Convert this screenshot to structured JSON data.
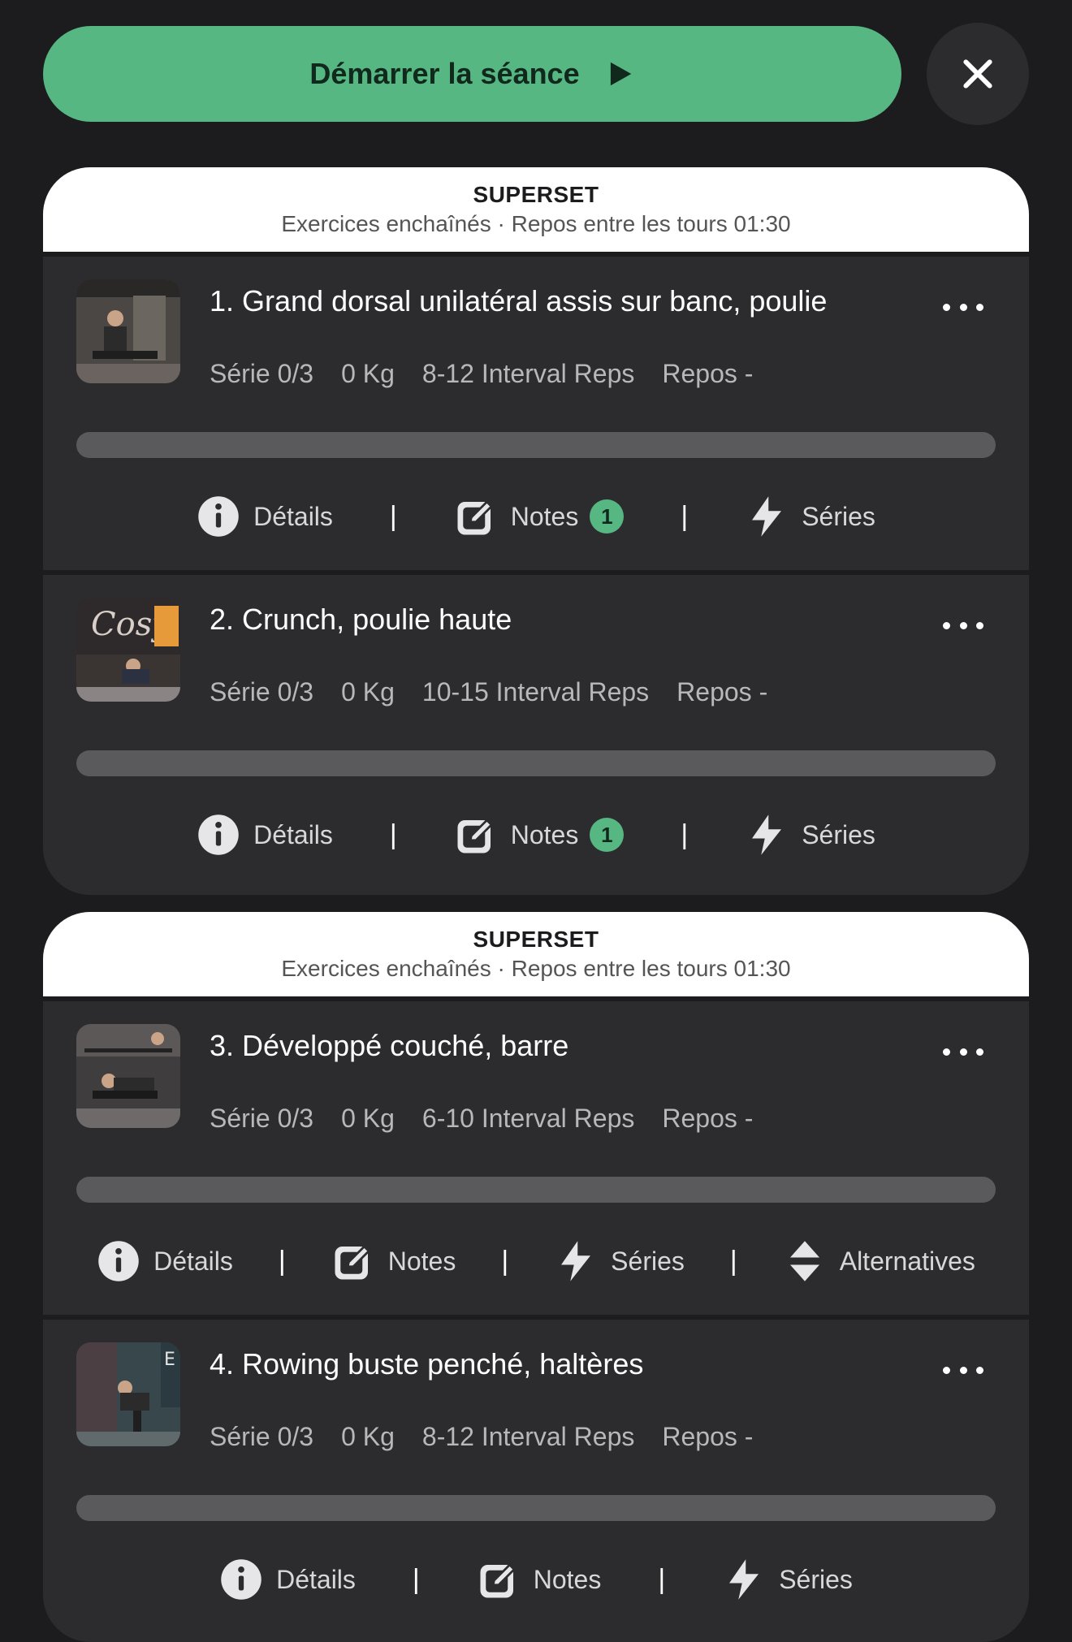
{
  "header": {
    "start_label": "Démarrer la séance",
    "accent_color": "#56b783"
  },
  "groups": [
    {
      "title": "SUPERSET",
      "subtitle": "Exercices enchaînés · Repos entre les tours 01:30",
      "exercises": [
        {
          "title": "1. Grand dorsal unilatéral assis sur banc, poulie",
          "serie": "Série 0/3",
          "weight": "0 Kg",
          "reps": "8-12 Interval Reps",
          "rest": "Repos -",
          "progress": 0,
          "details_label": "Détails",
          "notes_label": "Notes",
          "notes_count": "1",
          "series_label": "Séries"
        },
        {
          "title": "2. Crunch, poulie haute",
          "serie": "Série 0/3",
          "weight": "0 Kg",
          "reps": "10-15 Interval Reps",
          "rest": "Repos -",
          "progress": 0,
          "details_label": "Détails",
          "notes_label": "Notes",
          "notes_count": "1",
          "series_label": "Séries"
        }
      ]
    },
    {
      "title": "SUPERSET",
      "subtitle": "Exercices enchaînés · Repos entre les tours 01:30",
      "exercises": [
        {
          "title": "3. Développé couché, barre",
          "serie": "Série 0/3",
          "weight": "0 Kg",
          "reps": "6-10 Interval Reps",
          "rest": "Repos -",
          "progress": 0,
          "details_label": "Détails",
          "notes_label": "Notes",
          "series_label": "Séries",
          "alternatives_label": "Alternatives"
        },
        {
          "title": "4. Rowing buste penché, haltères",
          "serie": "Série 0/3",
          "weight": "0 Kg",
          "reps": "8-12 Interval Reps",
          "rest": "Repos -",
          "progress": 0,
          "details_label": "Détails",
          "notes_label": "Notes",
          "series_label": "Séries"
        }
      ]
    }
  ],
  "icons": {
    "start": "play-icon",
    "close": "close-icon",
    "details": "info-icon",
    "notes": "edit-note-icon",
    "series": "lightning-icon",
    "alternatives": "swap-vertical-icon",
    "more": "more-horizontal-icon"
  },
  "separator": "|"
}
